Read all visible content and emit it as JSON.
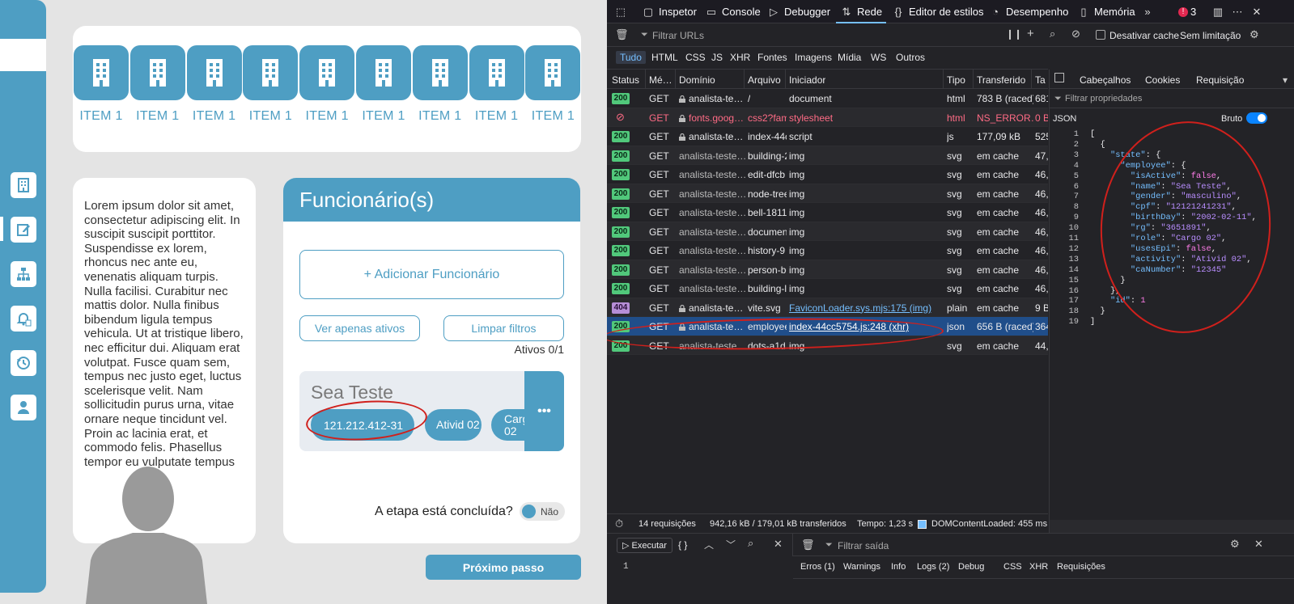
{
  "app": {
    "items": [
      "ITEM 1",
      "ITEM 1",
      "ITEM 1",
      "ITEM 1",
      "ITEM 1",
      "ITEM 1",
      "ITEM 1",
      "ITEM 1",
      "ITEM 1"
    ],
    "lorem": "Lorem ipsum dolor sit amet, consectetur adipiscing elit. In suscipit suscipit porttitor. Suspendisse ex lorem, rhoncus nec ante eu, venenatis aliquam turpis. Nulla facilisi. Curabitur nec mattis dolor. Nulla finibus bibendum ligula tempus vehicula. Ut at tristique libero, nec efficitur dui. Aliquam erat volutpat. Fusce quam sem, tempus nec justo eget, luctus scelerisque velit. Nam sollicitudin purus urna, vitae ornare neque tincidunt vel. Proin ac lacinia erat, et commodo felis. Phasellus tempor eu vulputate tempus",
    "panel_title": "Funcionário(s)",
    "add_button": "+ Adicionar Funcionário",
    "filter_active": "Ver apenas ativos",
    "filter_clear": "Limpar filtros",
    "ativos_count": "Ativos 0/1",
    "employee": {
      "name": "Sea Teste",
      "cpf": "121.212.412-31",
      "activity": "Ativid 02",
      "role": "Cargo 02",
      "more": "•••"
    },
    "etapa_question": "A etapa está concluída?",
    "toggle_label": "Não",
    "next_button": "Próximo passo",
    "accent": "#4e9ec3"
  },
  "devtools": {
    "toolbar": [
      "Inspetor",
      "Console",
      "Debugger",
      "Rede",
      "Editor de estilos",
      "Desempenho",
      "Memória"
    ],
    "errors_count": "3",
    "filter_placeholder": "Filtrar URLs",
    "disable_cache": "Desativar cache",
    "throttle": "Sem limitação",
    "types": [
      "Tudo",
      "HTML",
      "CSS",
      "JS",
      "XHR",
      "Fontes",
      "Imagens",
      "Mídia",
      "WS",
      "Outros"
    ],
    "columns": [
      "Status",
      "Mé…",
      "Domínio",
      "Arquivo",
      "Iniciador",
      "Tipo",
      "Transferido",
      "Ta"
    ],
    "rows": [
      {
        "status": "200",
        "method": "GET",
        "domain": "analista-te…",
        "file": "/",
        "initiator": "document",
        "type": "html",
        "transfer": "783 B (raced)",
        "size": "681"
      },
      {
        "status": "blocked",
        "method": "GET",
        "domain": "fonts.goog…",
        "file": "css2?fami",
        "initiator": "stylesheet",
        "type": "html",
        "transfer": "NS_ERROR…",
        "size": "0 B"
      },
      {
        "status": "200",
        "method": "GET",
        "domain": "analista-te…",
        "file": "index-44c",
        "initiator": "script",
        "type": "js",
        "transfer": "177,09 kB",
        "size": "525"
      },
      {
        "status": "200",
        "method": "GET",
        "domain": "analista-teste…",
        "file": "building-2",
        "initiator": "img",
        "type": "svg",
        "transfer": "em cache",
        "size": "47,"
      },
      {
        "status": "200",
        "method": "GET",
        "domain": "analista-teste…",
        "file": "edit-dfcb",
        "initiator": "img",
        "type": "svg",
        "transfer": "em cache",
        "size": "46,"
      },
      {
        "status": "200",
        "method": "GET",
        "domain": "analista-teste…",
        "file": "node-tree",
        "initiator": "img",
        "type": "svg",
        "transfer": "em cache",
        "size": "46,"
      },
      {
        "status": "200",
        "method": "GET",
        "domain": "analista-teste…",
        "file": "bell-1811",
        "initiator": "img",
        "type": "svg",
        "transfer": "em cache",
        "size": "46,"
      },
      {
        "status": "200",
        "method": "GET",
        "domain": "analista-teste…",
        "file": "documen",
        "initiator": "img",
        "type": "svg",
        "transfer": "em cache",
        "size": "46,"
      },
      {
        "status": "200",
        "method": "GET",
        "domain": "analista-teste…",
        "file": "history-9",
        "initiator": "img",
        "type": "svg",
        "transfer": "em cache",
        "size": "46,"
      },
      {
        "status": "200",
        "method": "GET",
        "domain": "analista-teste…",
        "file": "person-be",
        "initiator": "img",
        "type": "svg",
        "transfer": "em cache",
        "size": "46,"
      },
      {
        "status": "200",
        "method": "GET",
        "domain": "analista-teste…",
        "file": "building-l",
        "initiator": "img",
        "type": "svg",
        "transfer": "em cache",
        "size": "46,"
      },
      {
        "status": "404",
        "method": "GET",
        "domain": "analista-te…",
        "file": "vite.svg",
        "initiator": "FaviconLoader.sys.mjs:175 (img)",
        "type": "plain",
        "transfer": "em cache",
        "size": "9 B"
      },
      {
        "status": "200",
        "method": "GET",
        "domain": "analista-te…",
        "file": "employee",
        "initiator": "index-44cc5754.js:248 (xhr)",
        "type": "json",
        "transfer": "656 B (raced)",
        "size": "364"
      },
      {
        "status": "200",
        "method": "GET",
        "domain": "analista-teste…",
        "file": "dots-a1d",
        "initiator": "img",
        "type": "svg",
        "transfer": "em cache",
        "size": "44,"
      }
    ],
    "status_bar": {
      "requests": "14 requisições",
      "transferred": "942,16 kB / 179,01 kB transferidos",
      "time": "Tempo: 1,23 s",
      "dom": "DOMContentLoaded: 455 ms"
    },
    "detail_tabs": [
      "Cabeçalhos",
      "Cookies",
      "Requisição"
    ],
    "filter_props": "Filtrar propriedades",
    "json_label": "JSON",
    "raw_label": "Bruto",
    "json_lines": [
      [
        [
          "p",
          "["
        ]
      ],
      [
        [
          "p",
          "  {"
        ]
      ],
      [
        [
          "p",
          "    "
        ],
        [
          "k",
          "\"state\""
        ],
        [
          "p",
          ": {"
        ]
      ],
      [
        [
          "p",
          "      "
        ],
        [
          "k",
          "\"employee\""
        ],
        [
          "p",
          ": {"
        ]
      ],
      [
        [
          "p",
          "        "
        ],
        [
          "k",
          "\"isActive\""
        ],
        [
          "p",
          ": "
        ],
        [
          "v",
          "false"
        ],
        [
          "p",
          ","
        ]
      ],
      [
        [
          "p",
          "        "
        ],
        [
          "k",
          "\"name\""
        ],
        [
          "p",
          ": "
        ],
        [
          "s",
          "\"Sea Teste\""
        ],
        [
          "p",
          ","
        ]
      ],
      [
        [
          "p",
          "        "
        ],
        [
          "k",
          "\"gender\""
        ],
        [
          "p",
          ": "
        ],
        [
          "s",
          "\"masculino\""
        ],
        [
          "p",
          ","
        ]
      ],
      [
        [
          "p",
          "        "
        ],
        [
          "k",
          "\"cpf\""
        ],
        [
          "p",
          ": "
        ],
        [
          "s",
          "\"12121241231\""
        ],
        [
          "p",
          ","
        ]
      ],
      [
        [
          "p",
          "        "
        ],
        [
          "k",
          "\"birthDay\""
        ],
        [
          "p",
          ": "
        ],
        [
          "s",
          "\"2002-02-11\""
        ],
        [
          "p",
          ","
        ]
      ],
      [
        [
          "p",
          "        "
        ],
        [
          "k",
          "\"rg\""
        ],
        [
          "p",
          ": "
        ],
        [
          "s",
          "\"3651891\""
        ],
        [
          "p",
          ","
        ]
      ],
      [
        [
          "p",
          "        "
        ],
        [
          "k",
          "\"role\""
        ],
        [
          "p",
          ": "
        ],
        [
          "s",
          "\"Cargo 02\""
        ],
        [
          "p",
          ","
        ]
      ],
      [
        [
          "p",
          "        "
        ],
        [
          "k",
          "\"usesEpi\""
        ],
        [
          "p",
          ": "
        ],
        [
          "v",
          "false"
        ],
        [
          "p",
          ","
        ]
      ],
      [
        [
          "p",
          "        "
        ],
        [
          "k",
          "\"activity\""
        ],
        [
          "p",
          ": "
        ],
        [
          "s",
          "\"Ativid 02\""
        ],
        [
          "p",
          ","
        ]
      ],
      [
        [
          "p",
          "        "
        ],
        [
          "k",
          "\"caNumber\""
        ],
        [
          "p",
          ": "
        ],
        [
          "s",
          "\"12345\""
        ]
      ],
      [
        [
          "p",
          "      }"
        ]
      ],
      [
        [
          "p",
          "    },"
        ]
      ],
      [
        [
          "p",
          "    "
        ],
        [
          "k",
          "\"id\""
        ],
        [
          "p",
          ": "
        ],
        [
          "v",
          "1"
        ]
      ],
      [
        [
          "p",
          "  }"
        ]
      ],
      [
        [
          "p",
          "]"
        ]
      ]
    ],
    "console": {
      "run": "Executar",
      "braces": "{ }",
      "line_no": "1",
      "filter_output": "Filtrar saída",
      "tabs": [
        "Erros (1)",
        "Warnings",
        "Info",
        "Logs (2)",
        "Debug",
        "CSS",
        "XHR",
        "Requisições"
      ]
    }
  }
}
